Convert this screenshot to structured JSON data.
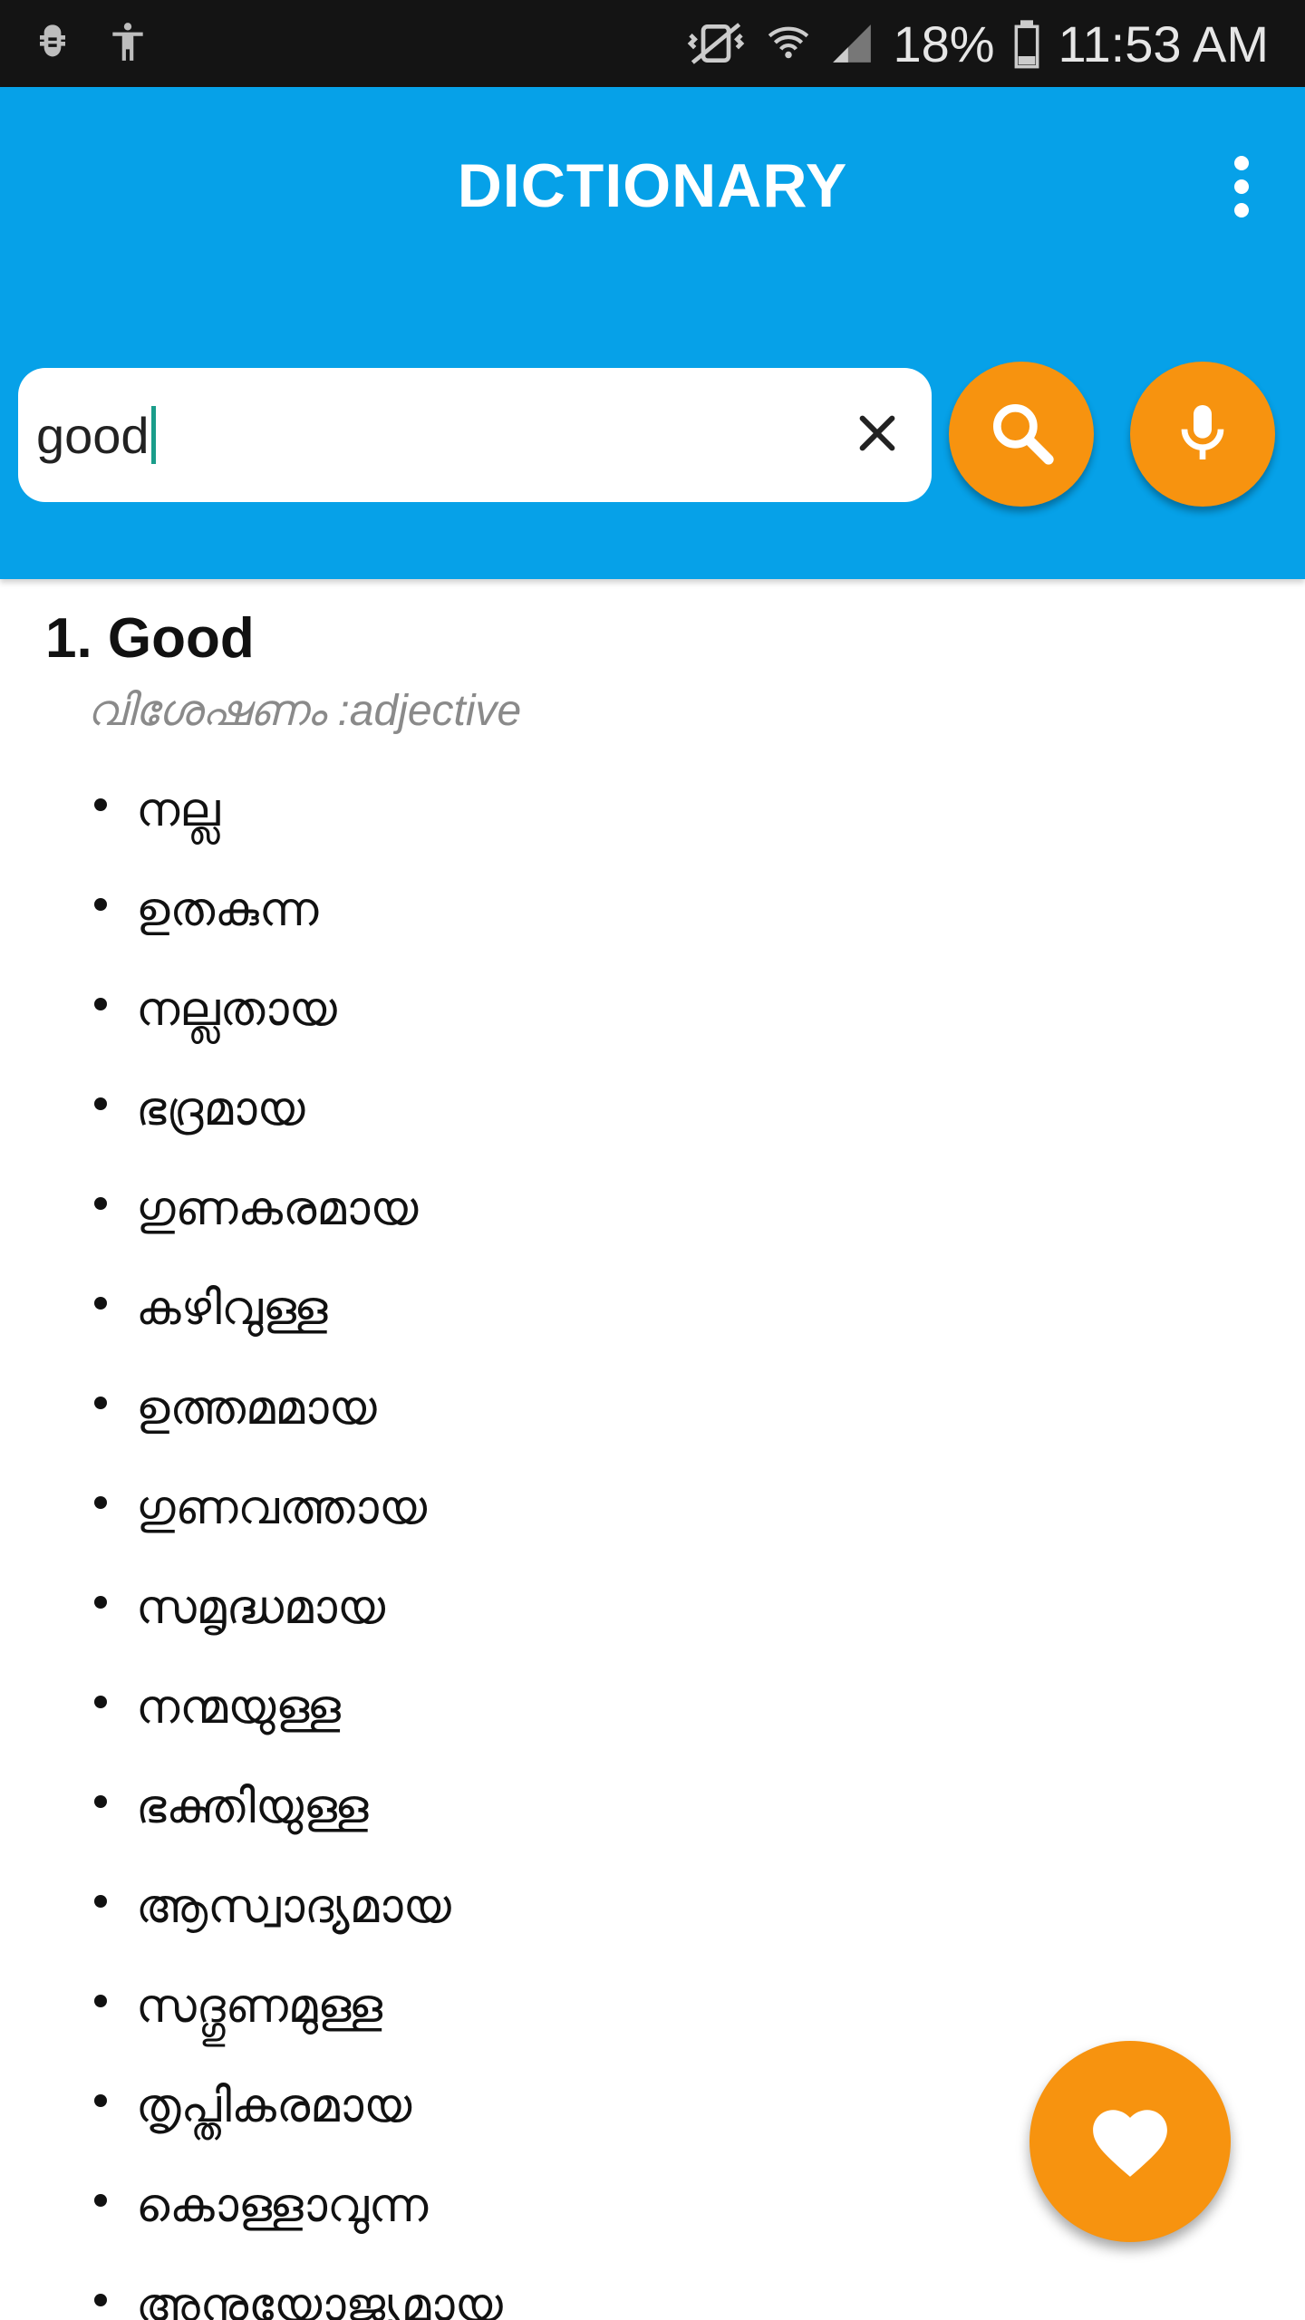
{
  "status_bar": {
    "battery": "18%",
    "time": "11:53 AM"
  },
  "app_bar": {
    "title": "DICTIONARY"
  },
  "search": {
    "value": "good",
    "placeholder": ""
  },
  "entry": {
    "title": "1. Good",
    "part_of_speech": "വിശേഷണം :adjective",
    "meanings": [
      "നല്ല",
      "ഉതകുന്ന",
      "നല്ലതായ",
      "ഭദ്രമായ",
      "ഗുണകരമായ",
      "കഴിവുള്ള",
      "ഉത്തമമായ",
      "ഗുണവത്തായ",
      "സമൃദ്ധമായ",
      "നന്മയുള്ള",
      "ഭക്തിയുള്ള",
      "ആസ്വാദ്യമായ",
      "സദ്ഗുണമുള്ള",
      "തൃപ്തികരമായ",
      "കൊള്ളാവുന്ന",
      "അനുയോജ്യമായ"
    ]
  },
  "icons": {
    "search": "search-icon",
    "mic": "mic-icon",
    "clear": "close-icon",
    "favorite": "heart-icon",
    "menu": "more-vert-icon"
  },
  "colors": {
    "app_bar": "#06a1e8",
    "accent": "#f7930f",
    "status_bar": "#141414"
  }
}
